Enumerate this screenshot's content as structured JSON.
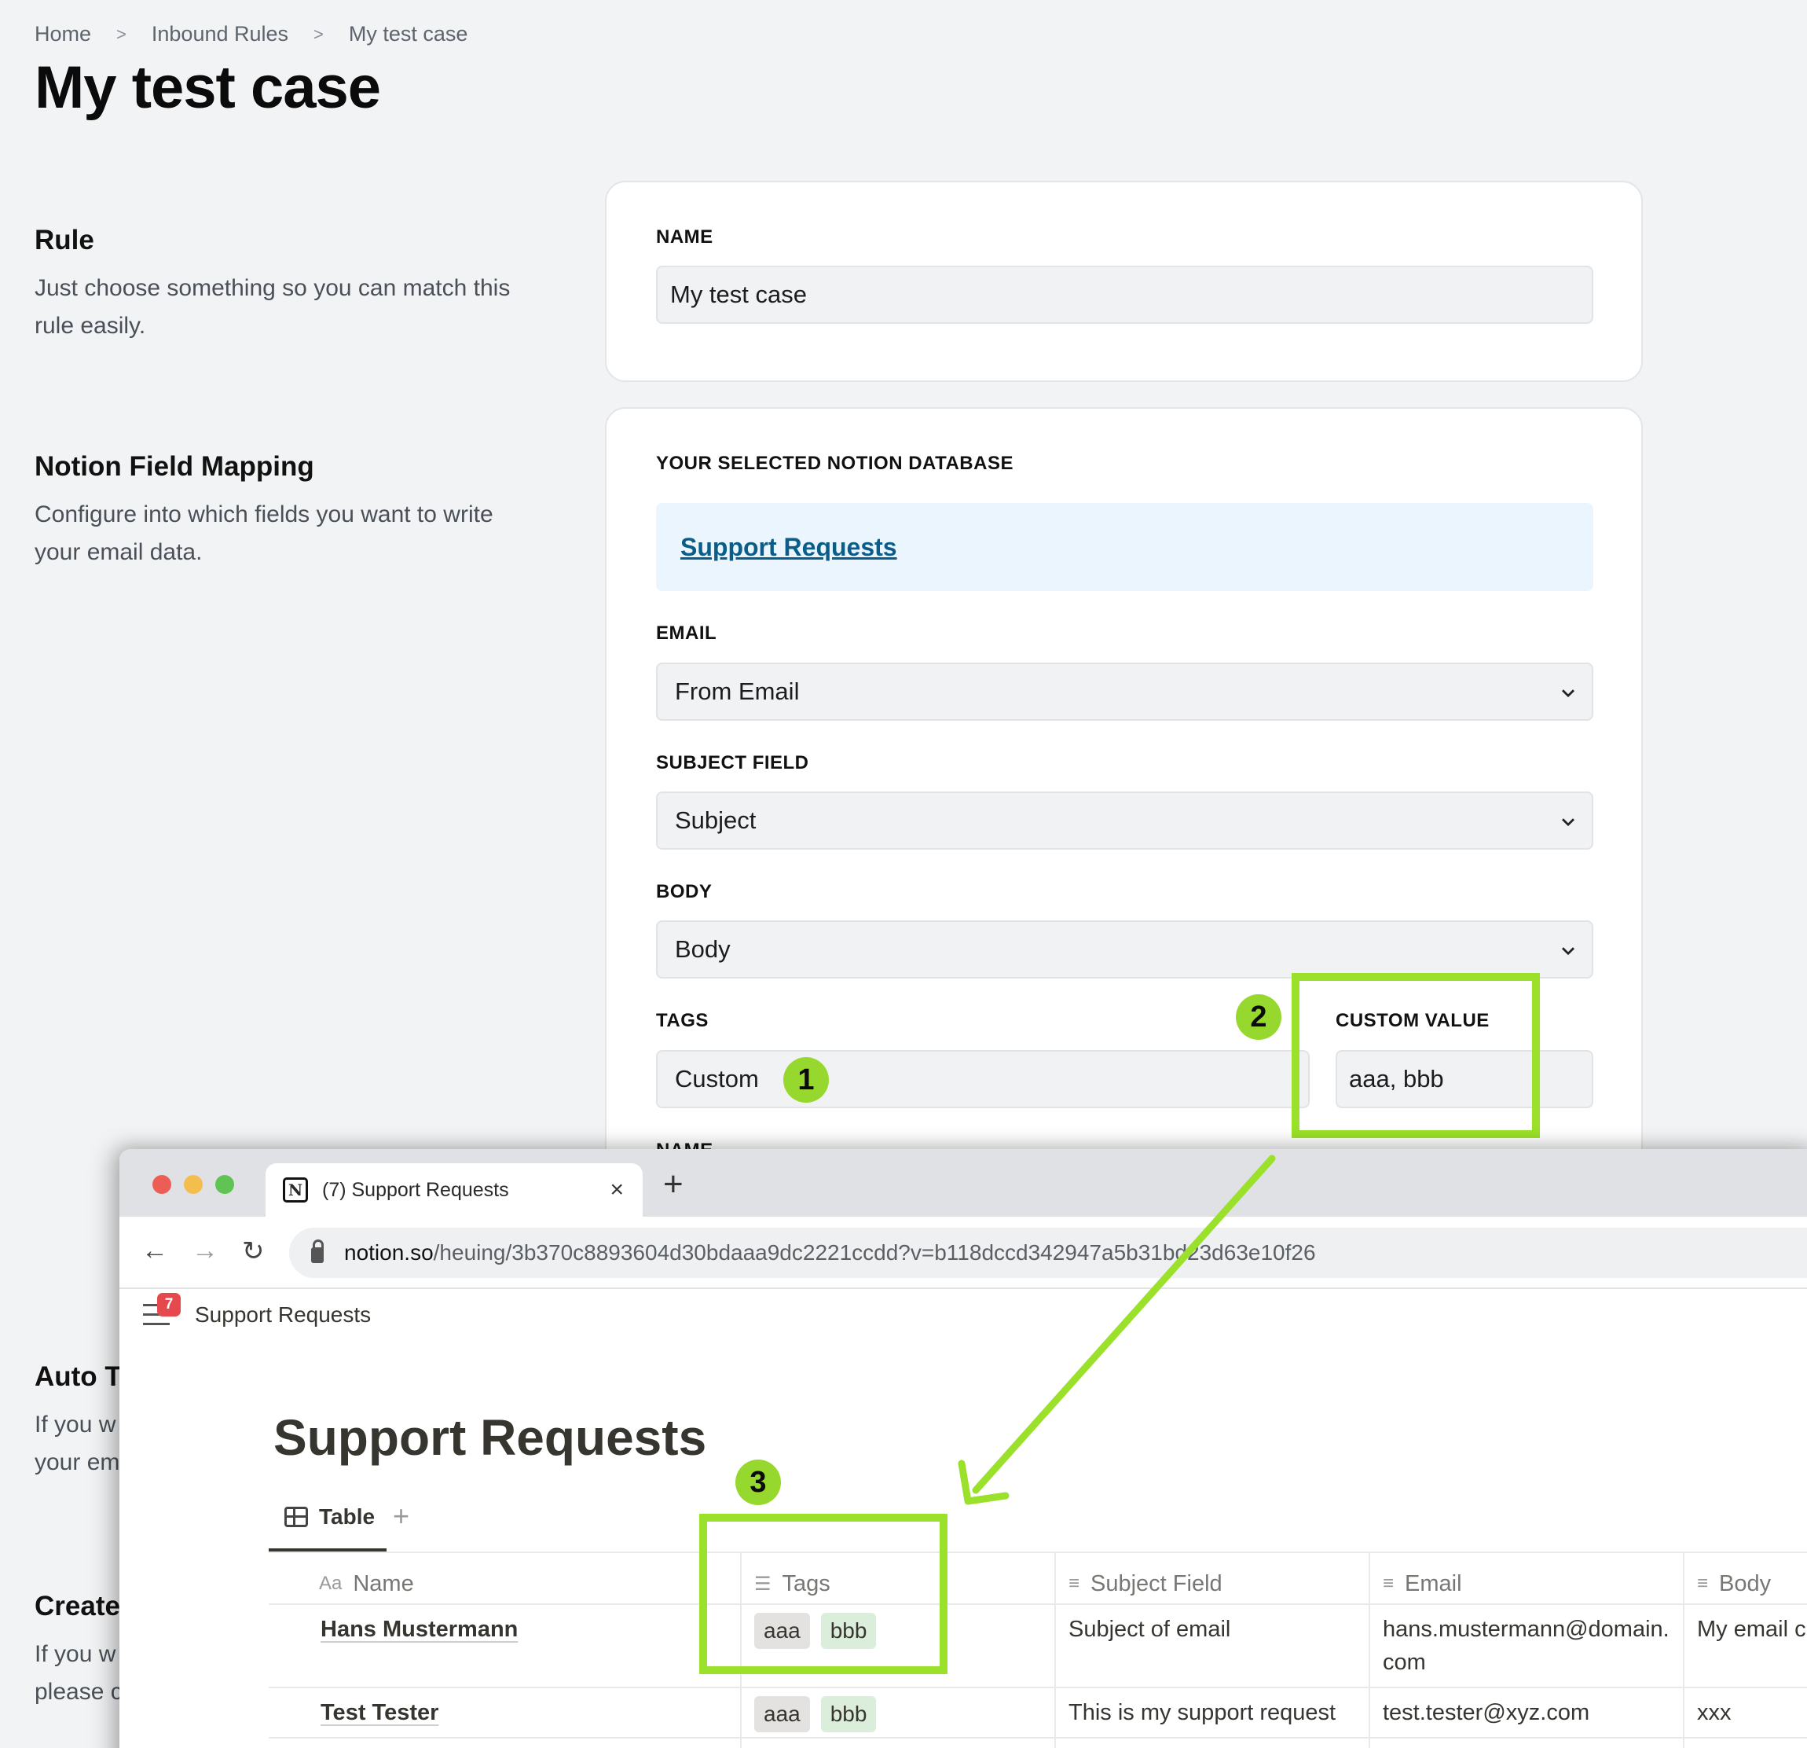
{
  "breadcrumb": [
    "Home",
    "Inbound Rules",
    "My test case"
  ],
  "page_title": "My test case",
  "sections": {
    "rule": {
      "title": "Rule",
      "description": "Just choose something so you can match this rule easily."
    },
    "mapping": {
      "title": "Notion Field Mapping",
      "description": "Configure into which fields you want to write your email data."
    },
    "auto": {
      "title": "Auto T",
      "description_line1": "If you w",
      "description_line2": "your em"
    },
    "create": {
      "title": "Create",
      "description_line1": "If you w",
      "description_line2": "please c"
    }
  },
  "rule_card": {
    "name_label": "NAME",
    "name_value": "My test case"
  },
  "mapping_card": {
    "db_label": "YOUR SELECTED NOTION DATABASE",
    "db_link": "Support Requests",
    "email_label": "EMAIL",
    "email_value": "From Email",
    "subject_label": "SUBJECT FIELD",
    "subject_value": "Subject",
    "body_label": "BODY",
    "body_value": "Body",
    "tags_label": "TAGS",
    "tags_value": "Custom",
    "custom_label": "CUSTOM VALUE",
    "custom_value": "aaa, bbb",
    "name_label_partial": "NAME"
  },
  "annotations": {
    "badge1": "1",
    "badge2": "2",
    "badge3": "3",
    "accent": "#96d82e"
  },
  "browser": {
    "tab_title": "(7) Support Requests",
    "tab_close": "×",
    "new_tab": "+",
    "url_host": "notion.so",
    "url_path": "/heuing/3b370c8893604d30bdaaa9dc2221ccdd?v=b118dccd342947a5b31bd23d63e10f26",
    "nav": {
      "back": "←",
      "forward": "→",
      "reload": "↻"
    }
  },
  "notion": {
    "breadcrumb_title": "Support Requests",
    "notification_count": "7",
    "page_title": "Support Requests",
    "view_tab": "Table",
    "view_add": "+",
    "columns": [
      {
        "icon": "Aa",
        "label": "Name"
      },
      {
        "icon": "☰",
        "label": "Tags"
      },
      {
        "icon": "≡",
        "label": "Subject Field"
      },
      {
        "icon": "≡",
        "label": "Email"
      },
      {
        "icon": "≡",
        "label": "Body"
      }
    ],
    "rows": [
      {
        "name": "Hans Mustermann",
        "tags": [
          "aaa",
          "bbb"
        ],
        "subject": "Subject of email",
        "email_line1": "hans.mustermann@domain.",
        "email_line2": "com",
        "body": "My email c"
      },
      {
        "name": "Test Tester",
        "tags": [
          "aaa",
          "bbb"
        ],
        "subject": "This is my support request",
        "email_line1": "test.tester@xyz.com",
        "email_line2": "",
        "body": "xxx"
      }
    ]
  }
}
